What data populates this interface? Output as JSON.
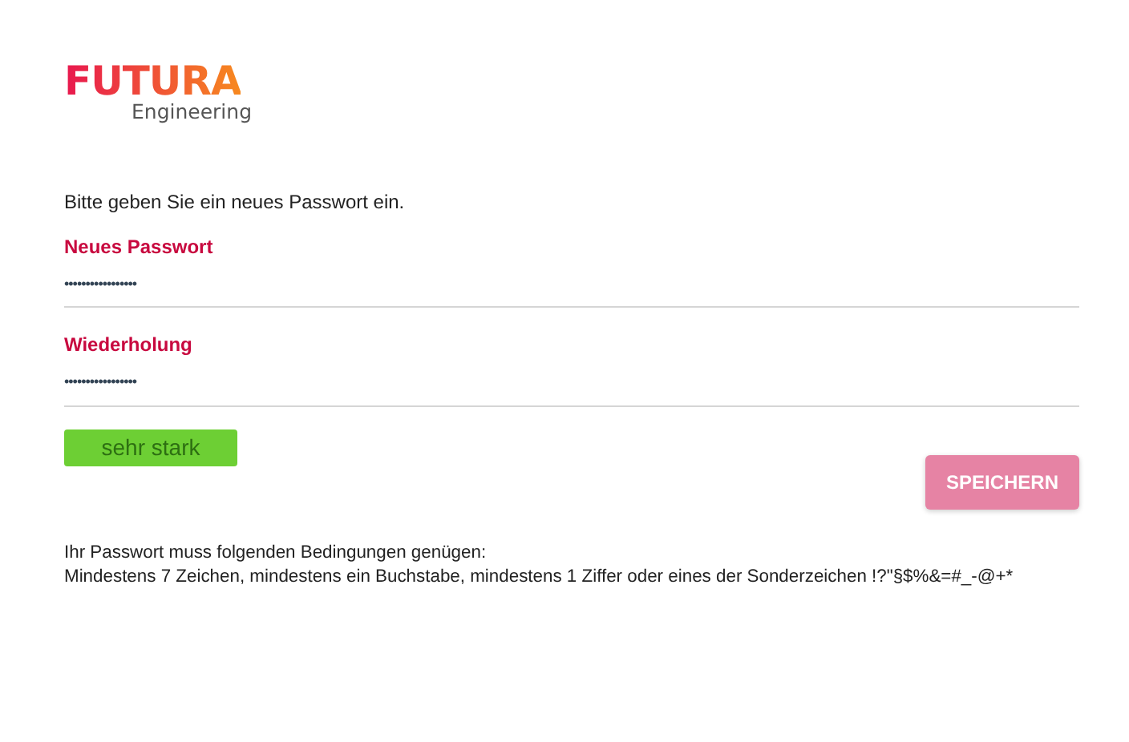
{
  "logo": {
    "brand": "FUTURA",
    "tagline": "Engineering"
  },
  "intro": "Bitte geben Sie ein neues Passwort ein.",
  "fields": [
    {
      "label": "Neues Passwort",
      "value": "•••••••••••••••••"
    },
    {
      "label": "Wiederholung",
      "value": "•••••••••••••••••"
    }
  ],
  "strength": {
    "label": "sehr stark",
    "level": 1
  },
  "save_button": {
    "label": "SPEICHERN",
    "disabled": true
  },
  "rules": [
    "Ihr Passwort muss folgenden Bedingungen genügen:",
    "Mindestens 7 Zeichen, mindestens ein Buchstabe, mindestens 1 Ziffer oder eines der Sonderzeichen !?\"§$%&=#_-@+*"
  ]
}
